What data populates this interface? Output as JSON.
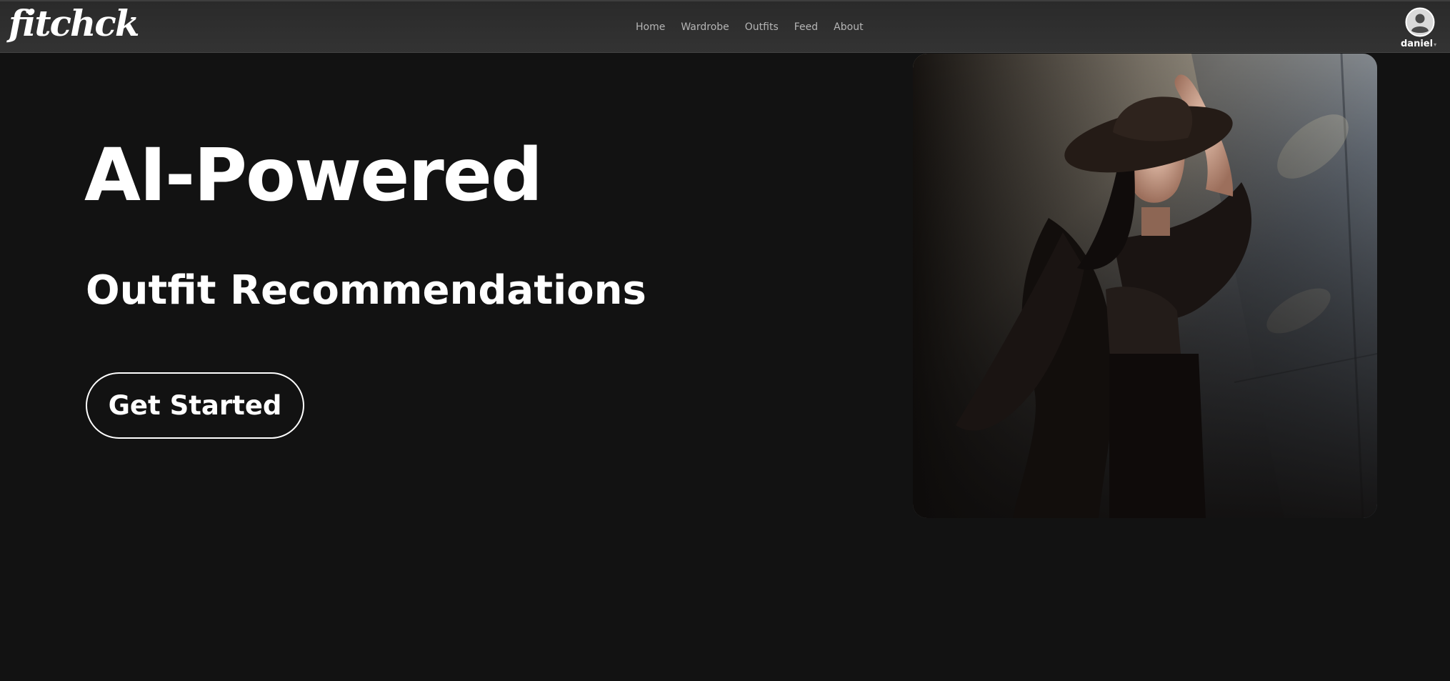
{
  "brand": {
    "logo_text": "fitchck"
  },
  "nav": {
    "links": [
      {
        "label": "Home"
      },
      {
        "label": "Wardrobe"
      },
      {
        "label": "Outfits"
      },
      {
        "label": "Feed"
      },
      {
        "label": "About"
      }
    ]
  },
  "user": {
    "name": "daniel",
    "avatar_icon": "user-avatar-icon",
    "caret_icon": "caret-down-icon"
  },
  "hero": {
    "title": "AI-Powered",
    "subtitle": "Outfit Recommendations",
    "cta_label": "Get Started",
    "image_subject": "fashion-model-photo"
  },
  "colors": {
    "background": "#121212",
    "navbar": "#313131",
    "text": "#ffffff",
    "nav_text": "#b5b5b5"
  }
}
